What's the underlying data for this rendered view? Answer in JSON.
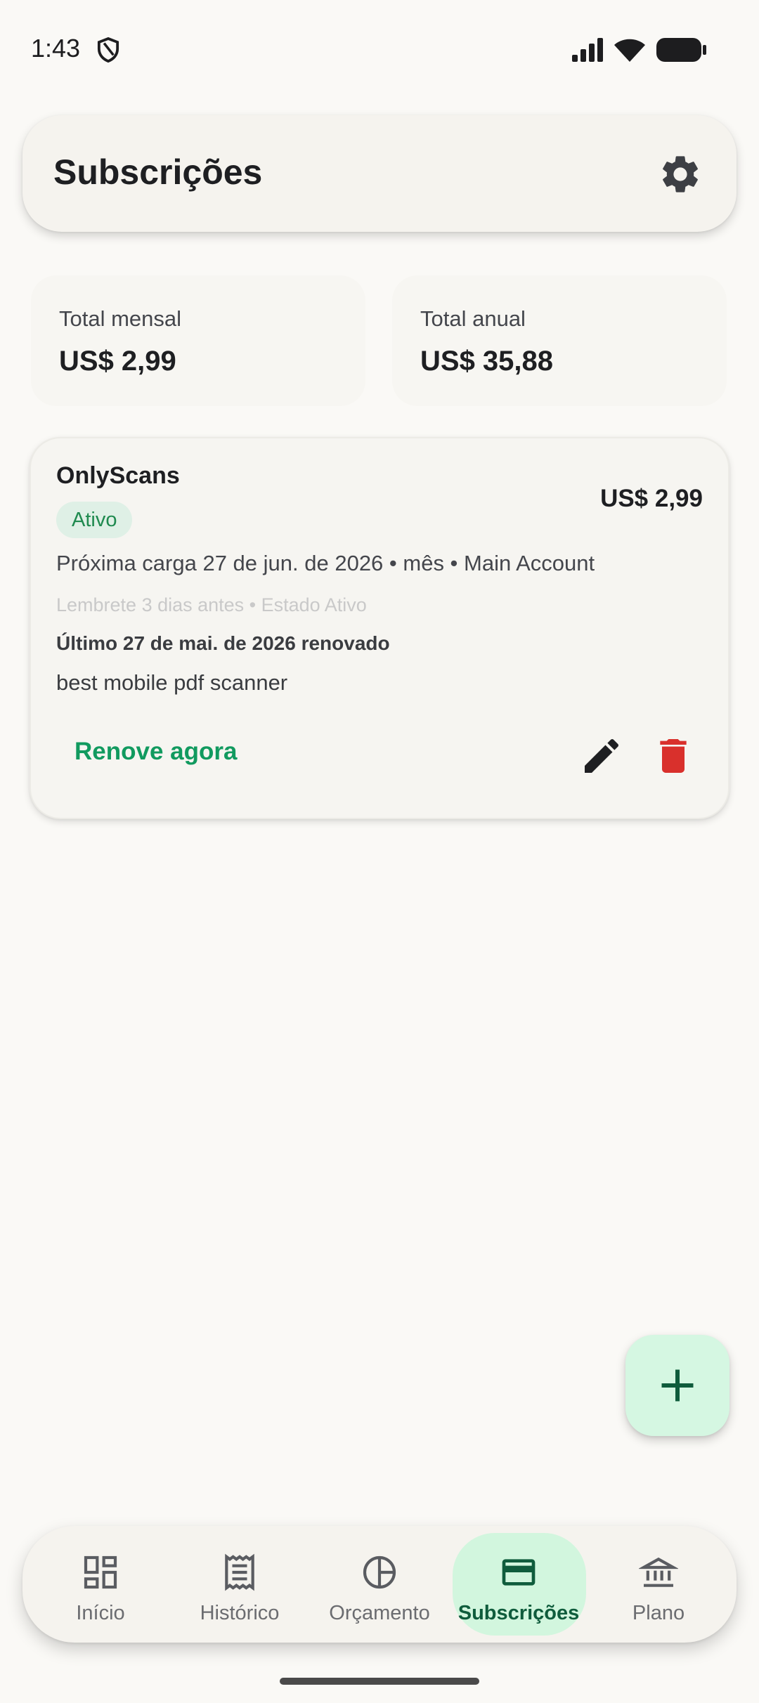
{
  "status_bar": {
    "time": "1:43",
    "icons": [
      "shield-icon",
      "signal-icon",
      "wifi-icon",
      "battery-icon"
    ]
  },
  "app_bar": {
    "title": "Subscrições",
    "settings_icon": "gear-icon"
  },
  "totals": {
    "monthly_label": "Total mensal",
    "monthly_value": "US$ 2,99",
    "yearly_label": "Total anual",
    "yearly_value": "US$ 35,88"
  },
  "subscriptions": [
    {
      "name": "OnlyScans",
      "price": "US$ 2,99",
      "status": "Ativo",
      "next_charge": "Próxima carga 27 de jun. de 2026 • mês • Main Account",
      "reminder": "Lembrete 3 dias antes • Estado Ativo",
      "last_renewal": "Último 27 de mai. de 2026 renovado",
      "note": "best mobile pdf scanner",
      "renew_label": "Renove agora",
      "edit_icon": "pencil-icon",
      "delete_icon": "trash-icon"
    }
  ],
  "fab": {
    "icon": "plus-icon"
  },
  "bottom_nav": {
    "items": [
      {
        "label": "Início",
        "icon": "dashboard-icon",
        "active": false
      },
      {
        "label": "Histórico",
        "icon": "receipt-icon",
        "active": false
      },
      {
        "label": "Orçamento",
        "icon": "pie-chart-icon",
        "active": false
      },
      {
        "label": "Subscrições",
        "icon": "credit-card-icon",
        "active": true
      },
      {
        "label": "Plano",
        "icon": "bank-icon",
        "active": false
      }
    ]
  },
  "colors": {
    "background": "#faf9f6",
    "accent_green": "#119a5f",
    "chip_green_bg": "#dff0e6",
    "fab_bg": "#d5f7e2",
    "active_nav_bg": "#d2f6de",
    "delete_red": "#d9302c"
  }
}
